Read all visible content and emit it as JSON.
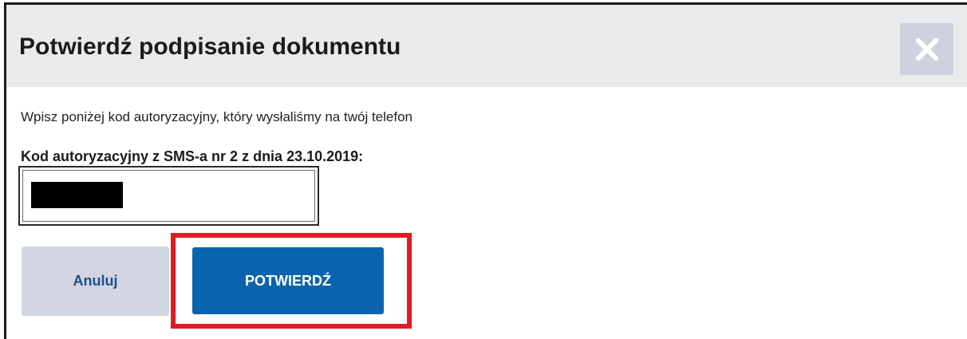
{
  "dialog": {
    "title": "Potwierdź podpisanie dokumentu",
    "close_icon": "close-icon",
    "description": "Wpisz poniżej kod autoryzacyjny, który wysłaliśmy na twój telefon",
    "field_label": "Kod autoryzacyjny z SMS-a nr 2 z dnia 23.10.2019:",
    "field_value": "",
    "cancel_label": "Anuluj",
    "confirm_label": "POTWIERDŹ"
  },
  "colors": {
    "header_bg": "#eaeaed",
    "close_bg": "#cdd2de",
    "cancel_bg": "#d2d6e2",
    "cancel_text": "#1d4f86",
    "confirm_bg": "#0a64ad",
    "highlight": "#e01b24"
  }
}
